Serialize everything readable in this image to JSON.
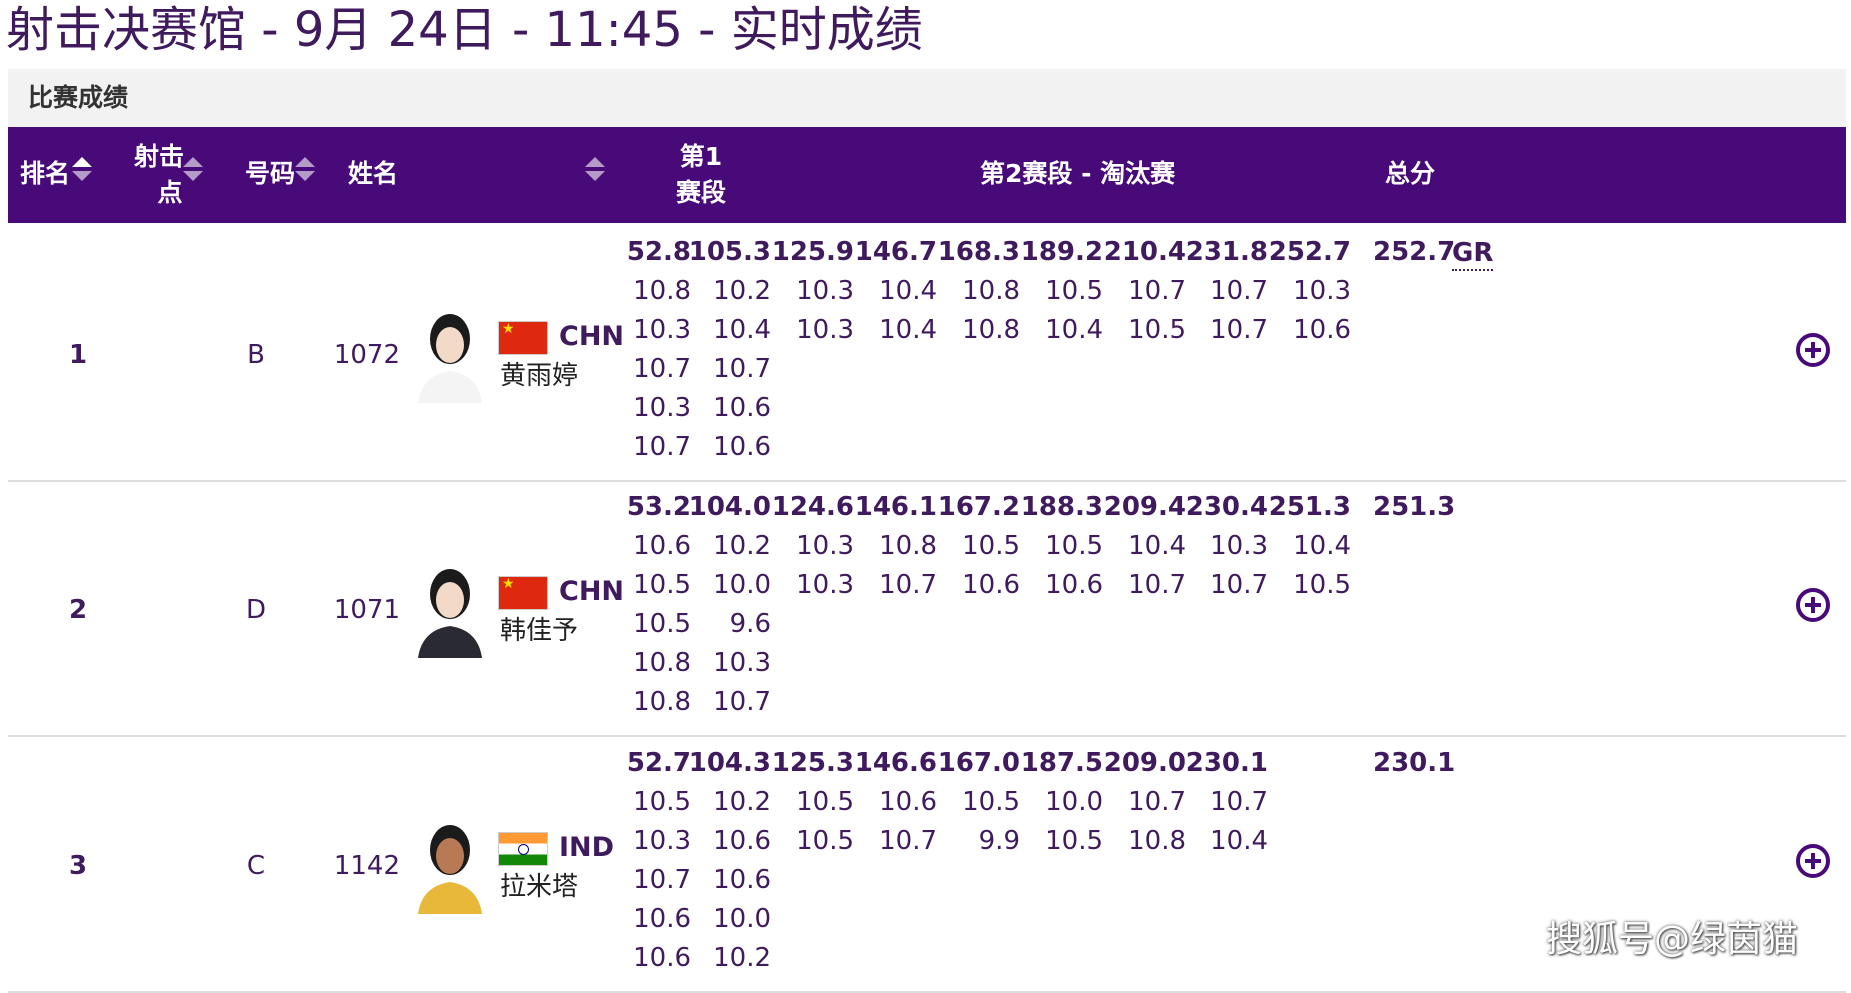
{
  "page": {
    "title": "射击决赛馆 - 9月 24日 - 11:45 - 实时成绩",
    "section_label": "比赛成绩"
  },
  "header": {
    "rank": "排名",
    "relay_line1": "射击",
    "relay_line2": "点",
    "bib": "号码",
    "name": "姓名",
    "stage1_line1": "第1",
    "stage1_line2": "赛段",
    "stage2": "第2赛段 - 淘汰赛",
    "total": "总分"
  },
  "colors": {
    "header_bg": "#470a78",
    "text_primary": "#3f1a5c",
    "section_bg": "#f2f2f2"
  },
  "rows": [
    {
      "rank": "1",
      "relay": "B",
      "bib": "1072",
      "noc": "CHN",
      "flag": "china-flag",
      "name": "黄雨婷",
      "cumulative": [
        "52.8",
        "105.3",
        "125.9",
        "146.7",
        "168.3",
        "189.2",
        "210.4",
        "231.8",
        "252.7"
      ],
      "total": "252.7",
      "record": "GR",
      "series": [
        [
          "10.8",
          "10.3",
          "10.7",
          "10.3",
          "10.7"
        ],
        [
          "10.2",
          "10.4",
          "10.7",
          "10.6",
          "10.6"
        ],
        [
          "10.3",
          "10.3"
        ],
        [
          "10.4",
          "10.4"
        ],
        [
          "10.8",
          "10.8"
        ],
        [
          "10.5",
          "10.4"
        ],
        [
          "10.7",
          "10.5"
        ],
        [
          "10.7",
          "10.7"
        ],
        [
          "10.3",
          "10.6"
        ]
      ]
    },
    {
      "rank": "2",
      "relay": "D",
      "bib": "1071",
      "noc": "CHN",
      "flag": "china-flag",
      "name": "韩佳予",
      "cumulative": [
        "53.2",
        "104.0",
        "124.6",
        "146.1",
        "167.2",
        "188.3",
        "209.4",
        "230.4",
        "251.3"
      ],
      "total": "251.3",
      "record": "",
      "series": [
        [
          "10.6",
          "10.5",
          "10.5",
          "10.8",
          "10.8"
        ],
        [
          "10.2",
          "10.0",
          "9.6",
          "10.3",
          "10.7"
        ],
        [
          "10.3",
          "10.3"
        ],
        [
          "10.8",
          "10.7"
        ],
        [
          "10.5",
          "10.6"
        ],
        [
          "10.5",
          "10.6"
        ],
        [
          "10.4",
          "10.7"
        ],
        [
          "10.3",
          "10.7"
        ],
        [
          "10.4",
          "10.5"
        ]
      ]
    },
    {
      "rank": "3",
      "relay": "C",
      "bib": "1142",
      "noc": "IND",
      "flag": "india-flag",
      "name": "拉米塔",
      "cumulative": [
        "52.7",
        "104.3",
        "125.3",
        "146.6",
        "167.0",
        "187.5",
        "209.0",
        "230.1",
        ""
      ],
      "total": "230.1",
      "record": "",
      "series": [
        [
          "10.5",
          "10.3",
          "10.7",
          "10.6",
          "10.6"
        ],
        [
          "10.2",
          "10.6",
          "10.6",
          "10.0",
          "10.2"
        ],
        [
          "10.5",
          "10.5"
        ],
        [
          "10.6",
          "10.7"
        ],
        [
          "10.5",
          "9.9"
        ],
        [
          "10.0",
          "10.5"
        ],
        [
          "10.7",
          "10.8"
        ],
        [
          "10.7",
          "10.4"
        ],
        []
      ]
    }
  ],
  "watermark": "搜狐号@绿茵猫"
}
